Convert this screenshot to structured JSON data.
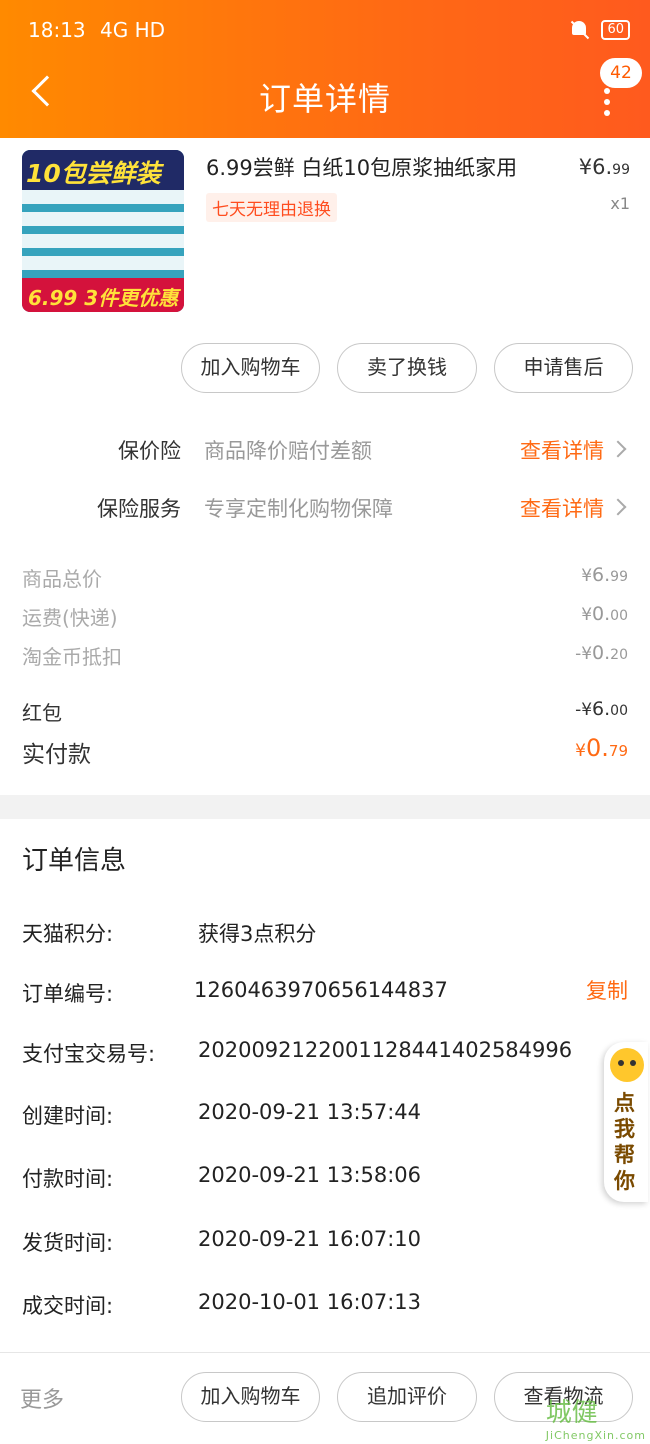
{
  "status": {
    "time": "18:13",
    "network": "4G HD",
    "battery": "60"
  },
  "header": {
    "title": "订单详情",
    "badge": "42"
  },
  "product": {
    "image_top_text": "10包尝鲜装",
    "image_bottom_text": "6.99 3件更优惠",
    "name": "6.99尝鲜 白纸10包原浆抽纸家用",
    "tag": "七天无理由退换",
    "price_symbol": "¥",
    "price_int": "6.",
    "price_dec": "99",
    "qty": "x1"
  },
  "actions_top": [
    "加入购物车",
    "卖了换钱",
    "申请售后"
  ],
  "insurance": [
    {
      "label": "保价险",
      "desc": "商品降价赔付差额",
      "link": "查看详情"
    },
    {
      "label": "保险服务",
      "desc": "专享定制化购物保障",
      "link": "查看详情"
    }
  ],
  "fees": [
    {
      "label": "商品总价",
      "prefix": "¥",
      "int": "6.",
      "dec": "99"
    },
    {
      "label": "运费(快递)",
      "prefix": "¥",
      "int": "0.",
      "dec": "00"
    },
    {
      "label": "淘金币抵扣",
      "prefix": "-¥",
      "int": "0.",
      "dec": "20"
    },
    {
      "label": "红包",
      "prefix": "-¥",
      "int": "6.",
      "dec": "00"
    }
  ],
  "paid": {
    "label": "实付款",
    "prefix": "¥",
    "int": "0.",
    "dec": "79"
  },
  "order_info": {
    "title": "订单信息",
    "rows": [
      {
        "label": "天猫积分:",
        "value": "获得3点积分"
      },
      {
        "label": "订单编号:",
        "value": "1260463970656144837"
      },
      {
        "label": "支付宝交易号:",
        "value": "2020092122001128441402584996"
      },
      {
        "label": "创建时间:",
        "value": "2020-09-21 13:57:44"
      },
      {
        "label": "付款时间:",
        "value": "2020-09-21 13:58:06"
      },
      {
        "label": "发货时间:",
        "value": "2020-09-21 16:07:10"
      },
      {
        "label": "成交时间:",
        "value": "2020-10-01 16:07:13"
      }
    ],
    "copy_label": "复制"
  },
  "helper": {
    "text": "点我帮你"
  },
  "bottom_bar": {
    "more": "更多",
    "buttons": [
      "加入购物车",
      "追加评价",
      "查看物流"
    ]
  },
  "watermark": {
    "text": "城健",
    "sub": "JiChengXin.com"
  },
  "colors": {
    "accent": "#ff6a14",
    "header_start": "#ff8a00",
    "header_end": "#ff5a1e"
  }
}
